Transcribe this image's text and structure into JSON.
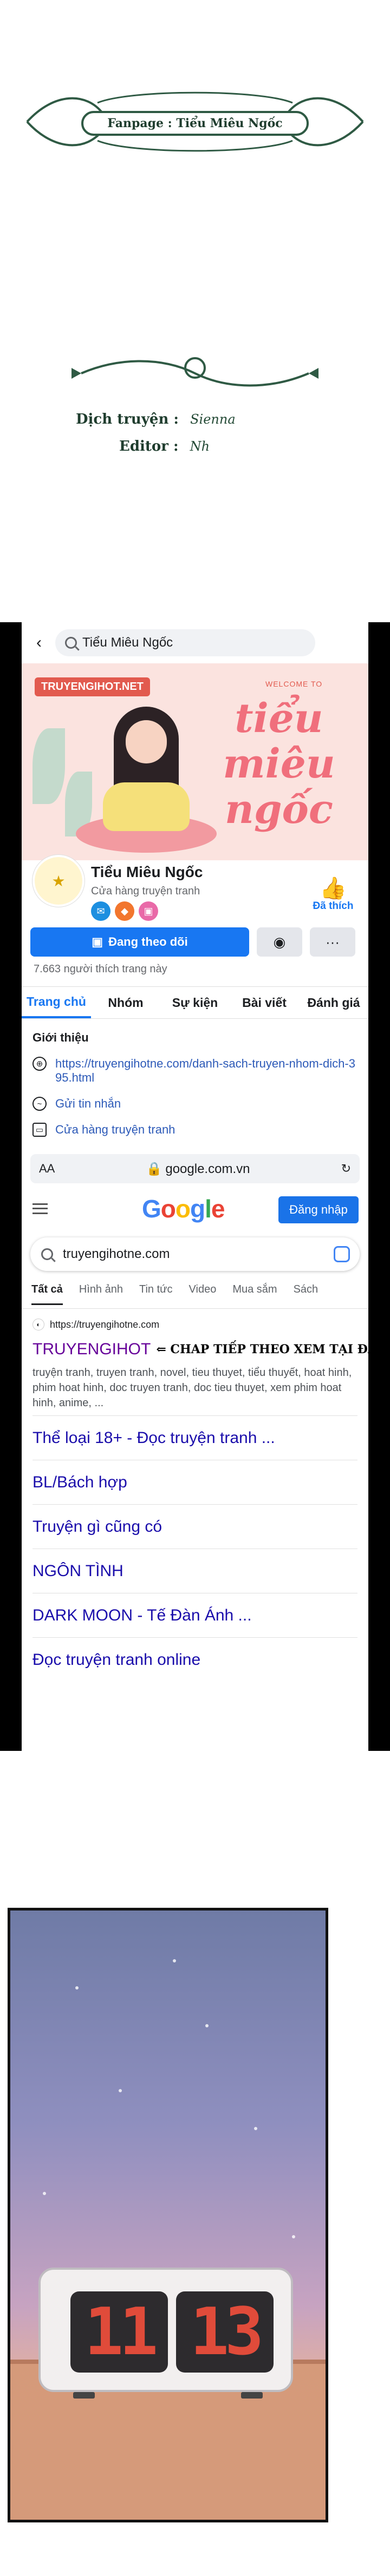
{
  "credits": {
    "fanpage": "Fanpage : Tiểu Miêu Ngốc",
    "translator_label": "Dịch truyện :",
    "translator_sig": "Sienna",
    "editor_label": "Editor :",
    "editor_sig": "Nh"
  },
  "facebook": {
    "search_text": "Tiểu Miêu Ngốc",
    "cover": {
      "site": "TRUYENGIHOT.NET",
      "welcome": "WELCOME TO",
      "title": "tiểu miêu ngốc"
    },
    "page_name": "Tiểu Miêu Ngốc",
    "page_category": "Cửa hàng truyện tranh",
    "liked_label": "Đã thích",
    "follow_label": "Đang theo dõi",
    "more_label": "···",
    "likes_count": "7.663 người thích trang này",
    "tabs": [
      "Trang chủ",
      "Nhóm",
      "Sự kiện",
      "Bài viết",
      "Đánh giá"
    ],
    "intro_title": "Giới thiệu",
    "intro_link": "https://truyengihotne.com/danh-sach-truyen-nhom-dich-395.html",
    "intro_message": "Gửi tin nhắn",
    "intro_shop": "Cửa hàng truyện tranh"
  },
  "browser": {
    "aa": "AA",
    "url": "google.com.vn",
    "reload_icon": "reload-icon"
  },
  "google": {
    "logo": [
      "G",
      "o",
      "o",
      "g",
      "l",
      "e"
    ],
    "logo_colors": [
      "#4285f4",
      "#ea4335",
      "#fbbc05",
      "#4285f4",
      "#34a853",
      "#ea4335"
    ],
    "login_label": "Đăng nhập",
    "query": "truyengihotne.com",
    "tabs": [
      "Tất cả",
      "Hình ảnh",
      "Tin tức",
      "Video",
      "Mua sắm",
      "Sách"
    ],
    "result": {
      "site_url": "https://truyengihotne.com",
      "title": "TRUYENGIHOT",
      "note": "⇐ CHAP TIẾP THEO XEM TẠI ĐÂY NHA",
      "snippet": "truyện tranh, truyen tranh, novel, tieu thuyet, tiểu thuyết, hoat hinh, phim hoat hinh, doc truyen tranh, doc tieu thuyet, xem phim hoat hinh, anime, ..."
    },
    "links": [
      "Thể loại 18+ - Đọc truyện tranh ...",
      "BL/Bách hợp",
      "Truyện gì cũng có",
      "NGÔN TÌNH",
      "DARK MOON - Tế Đàn Ánh ...",
      "Đọc truyện tranh online"
    ]
  },
  "comic": {
    "clock_left": "11",
    "clock_right": "13"
  }
}
